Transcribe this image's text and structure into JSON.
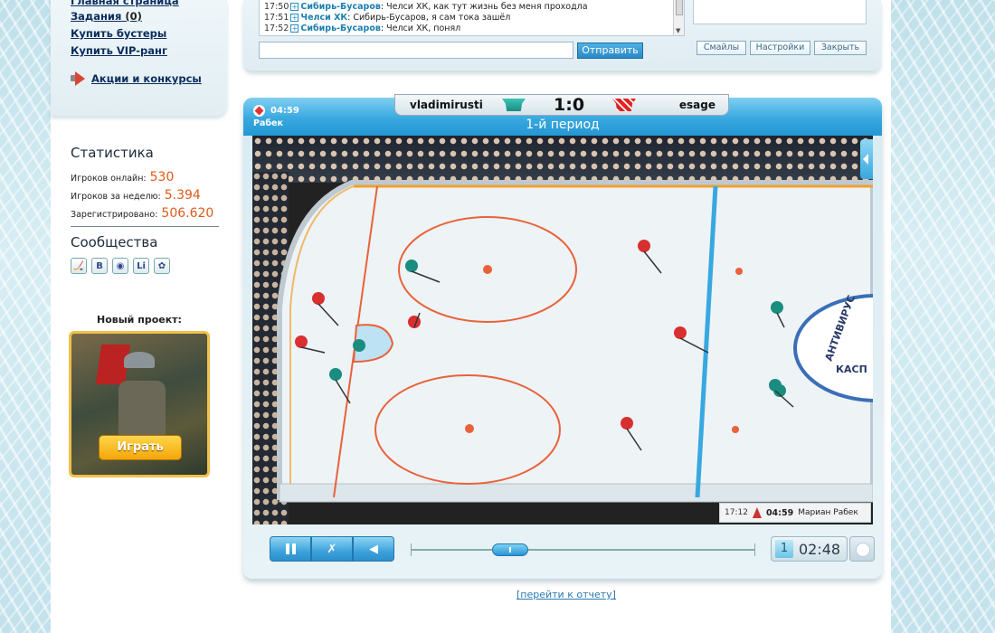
{
  "menu": {
    "items": [
      {
        "label": "Главная страница"
      },
      {
        "label": "Задания",
        "count": "(0)"
      },
      {
        "label": "Купить бустеры"
      },
      {
        "label": "Купить VIP-ранг"
      }
    ],
    "promo": "Акции и конкурсы"
  },
  "stats": {
    "title": "Статистика",
    "online_label": "Игроков онлайн:",
    "online": "530",
    "week_label": "Игроков за неделю:",
    "week": "5.394",
    "reg_label": "Зарегистрировано:",
    "reg": "506.620"
  },
  "communities": {
    "title": "Сообщества",
    "icons": [
      "hockey-icon",
      "vk-icon",
      "odnoklassniki-icon",
      "livejournal-icon",
      "moymir-icon"
    ],
    "glyphs": [
      "🏒",
      "B",
      "◉",
      "Li",
      "✿"
    ]
  },
  "new_project": {
    "label": "Новый проект:",
    "play": "Играть"
  },
  "chat": {
    "lines": [
      {
        "time": "17:50",
        "name": "Сибирь-Бусаров",
        "text": ": Челси ХК, как тут жизнь без меня проходла"
      },
      {
        "time": "17:51",
        "name": "Челси ХК",
        "text": ": Сибирь-Бусаров, я сам тока зашёл"
      },
      {
        "time": "17:52",
        "name": "Сибирь-Бусаров",
        "text": ": Челси ХК, понял"
      }
    ],
    "send": "Отправить",
    "smiles": "Смайлы",
    "settings": "Настройки",
    "close": "Закрыть"
  },
  "game": {
    "player_left": "vladimirusti",
    "player_right": "esage",
    "score": "1:0",
    "period": "1-й период",
    "header_time": "04:59",
    "header_name": "Рабек",
    "event_time": "17:12",
    "event_clock": "04:59",
    "event_name": "Мариан Рабек",
    "board_text_1": "АНТИВИРУС",
    "board_text_2": "КАСП",
    "current_period": "1",
    "clock": "02:48",
    "progress": 0.25
  },
  "report_link": "[перейти к отчету]",
  "colors": {
    "accent": "#2b95d2",
    "orange": "#e05a1a",
    "team_a": "#1a8d80",
    "team_b": "#e02222"
  }
}
